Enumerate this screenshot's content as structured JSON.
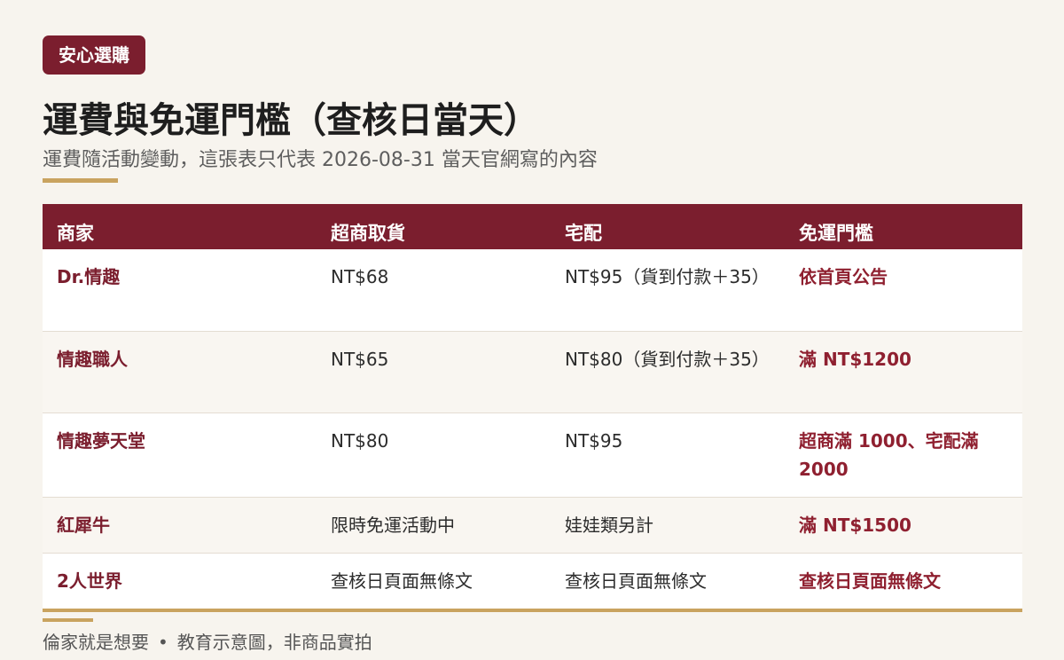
{
  "badge": "安心選購",
  "title": "運費與免運門檻（查核日當天）",
  "subtitle": "運費隨活動變動，這張表只代表 2026-08-31 當天官網寫的內容",
  "table": {
    "headers": [
      "商家",
      "超商取貨",
      "宅配",
      "免運門檻"
    ],
    "rows": [
      {
        "merchant": "Dr.情趣",
        "store_pickup": "NT$68",
        "home_delivery": "NT$95（貨到付款＋35）",
        "free_threshold": "依首頁公告"
      },
      {
        "merchant": "情趣職人",
        "store_pickup": "NT$65",
        "home_delivery": "NT$80（貨到付款＋35）",
        "free_threshold": "滿 NT$1200"
      },
      {
        "merchant": "情趣夢天堂",
        "store_pickup": "NT$80",
        "home_delivery": "NT$95",
        "free_threshold": "超商滿 1000、宅配滿 2000"
      },
      {
        "merchant": "紅犀牛",
        "store_pickup": "限時免運活動中",
        "home_delivery": "娃娃類另計",
        "free_threshold": "滿 NT$1500"
      },
      {
        "merchant": "2人世界",
        "store_pickup": "查核日頁面無條文",
        "home_delivery": "查核日頁面無條文",
        "free_threshold": "查核日頁面無條文"
      }
    ]
  },
  "footer": {
    "brand": "倫家就是想要",
    "separator": "•",
    "note": "教育示意圖，非商品實拍"
  },
  "colors": {
    "accent": "#7b1e2e",
    "gold": "#c9a35f",
    "background": "#f7f4ee"
  }
}
